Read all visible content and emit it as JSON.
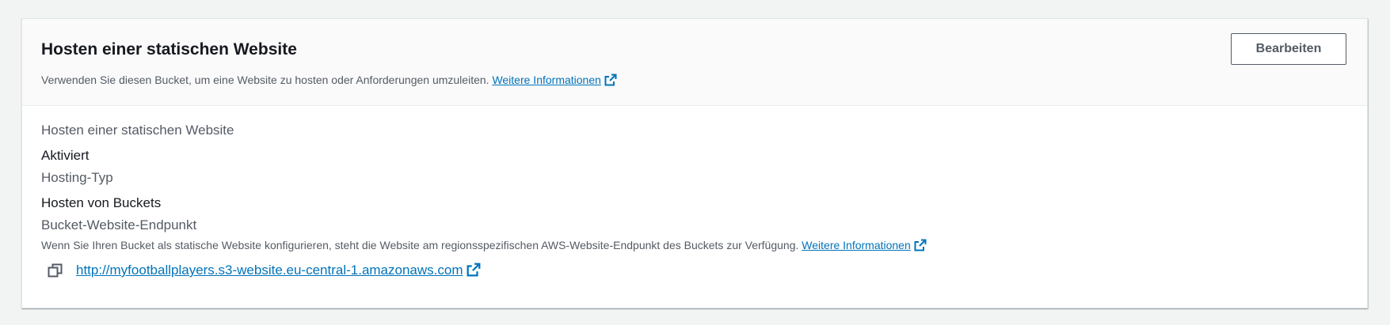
{
  "header": {
    "title": "Hosten einer statischen Website",
    "description": "Verwenden Sie diesen Bucket, um eine Website zu hosten oder Anforderungen umzuleiten.",
    "info_link": "Weitere Informationen",
    "edit_label": "Bearbeiten"
  },
  "body": {
    "hosting_label": "Hosten einer statischen Website",
    "hosting_value": "Aktiviert",
    "type_label": "Hosting-Typ",
    "type_value": "Hosten von Buckets",
    "endpoint_label": "Bucket-Website-Endpunkt",
    "endpoint_help": "Wenn Sie Ihren Bucket als statische Website konfigurieren, steht die Website am regionsspezifischen AWS-Website-Endpunkt des Buckets zur Verfügung.",
    "endpoint_info_link": "Weitere Informationen",
    "endpoint_url": "http://myfootballplayers.s3-website.eu-central-1.amazonaws.com"
  },
  "icons": {
    "external_link": "external-link-icon",
    "copy": "copy-icon"
  },
  "colors": {
    "link": "#0073bb",
    "text": "#16191f",
    "secondary_text": "#545b64",
    "header_bg": "#fafafa",
    "page_bg": "#f2f3f3"
  }
}
